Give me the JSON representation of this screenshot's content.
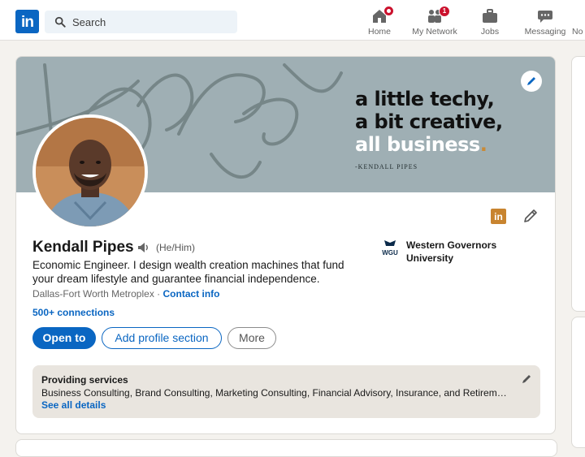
{
  "nav": {
    "logo": "in",
    "search_placeholder": "Search",
    "items": [
      {
        "label": "Home",
        "icon": "home-icon",
        "badge": ""
      },
      {
        "label": "My Network",
        "icon": "network-icon",
        "badge": "1"
      },
      {
        "label": "Jobs",
        "icon": "briefcase-icon",
        "badge": ""
      },
      {
        "label": "Messaging",
        "icon": "messaging-icon",
        "badge": ""
      },
      {
        "label": "No",
        "icon": "notifications-icon",
        "badge": ""
      }
    ]
  },
  "banner": {
    "line1": "a little techy,",
    "line2": "a bit creative,",
    "line3": "all business",
    "line3_dot": ".",
    "byline": "-KENDALL PIPES",
    "bg_color": "#9fafb4"
  },
  "profile": {
    "name": "Kendall Pipes",
    "pronouns": "(He/Him)",
    "headline": "Economic Engineer. I design wealth creation machines that fund your dream lifestyle and guarantee financial independence.",
    "location": "Dallas-Fort Worth Metroplex",
    "separator": " · ",
    "contact_info": "Contact info",
    "connections": "500+ connections",
    "education": "Western Governors University",
    "education_logo_text": "WGU"
  },
  "actions": {
    "open_to": "Open to",
    "add_section": "Add profile section",
    "more": "More"
  },
  "services": {
    "title": "Providing services",
    "list": "Business Consulting, Brand Consulting, Marketing Consulting, Financial Advisory, Insurance, and Retirem…",
    "see_all": "See all details"
  },
  "colors": {
    "primary": "#0a66c2",
    "badge": "#cb112d",
    "accent": "#c8842f"
  }
}
